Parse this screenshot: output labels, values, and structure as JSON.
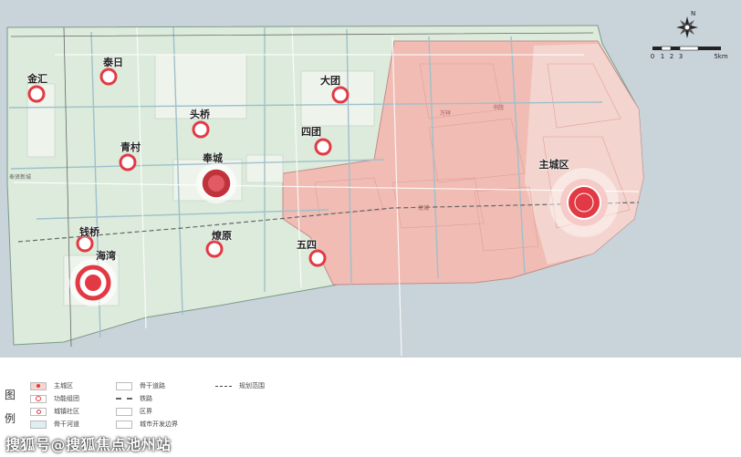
{
  "map": {
    "towns": [
      {
        "name": "金汇",
        "kind": "town"
      },
      {
        "name": "泰日",
        "kind": "town"
      },
      {
        "name": "大团",
        "kind": "town"
      },
      {
        "name": "头桥",
        "kind": "town"
      },
      {
        "name": "青村",
        "kind": "town"
      },
      {
        "name": "四团",
        "kind": "town"
      },
      {
        "name": "奉城",
        "kind": "functional-cluster"
      },
      {
        "name": "钱桥",
        "kind": "town"
      },
      {
        "name": "海湾",
        "kind": "functional-cluster"
      },
      {
        "name": "燎原",
        "kind": "town"
      },
      {
        "name": "五四",
        "kind": "town"
      },
      {
        "name": "主城区",
        "kind": "main-city"
      }
    ],
    "compass": {
      "north_label": "N"
    },
    "scale_bar": {
      "ticks": [
        "0",
        "1",
        "2",
        "3",
        "5km"
      ]
    },
    "colors": {
      "water": "#c6d1d9",
      "green_land": "#dcebdb",
      "planning_zone": "#f1b7b0",
      "main_city_zone": "#f5d6d1",
      "marker_red": "#e23a44"
    }
  },
  "legend": {
    "title_top": "图",
    "title_bottom": "例",
    "items": [
      {
        "label": "主城区",
        "icon": "main-city-icon"
      },
      {
        "label": "功能组团",
        "icon": "functional-cluster-icon"
      },
      {
        "label": "城镇社区",
        "icon": "town-community-icon"
      },
      {
        "label": "骨干河道",
        "icon": "river-icon"
      },
      {
        "label": "骨干道路",
        "icon": "road-icon"
      },
      {
        "label": "铁路",
        "icon": "railway-icon"
      },
      {
        "label": "区界",
        "icon": "district-boundary-icon"
      },
      {
        "label": "城市开发边界",
        "icon": "development-boundary-icon"
      },
      {
        "label": "规划范围",
        "icon": "planning-range-icon"
      }
    ]
  },
  "watermark": "搜狐号@搜狐焦点池州站"
}
